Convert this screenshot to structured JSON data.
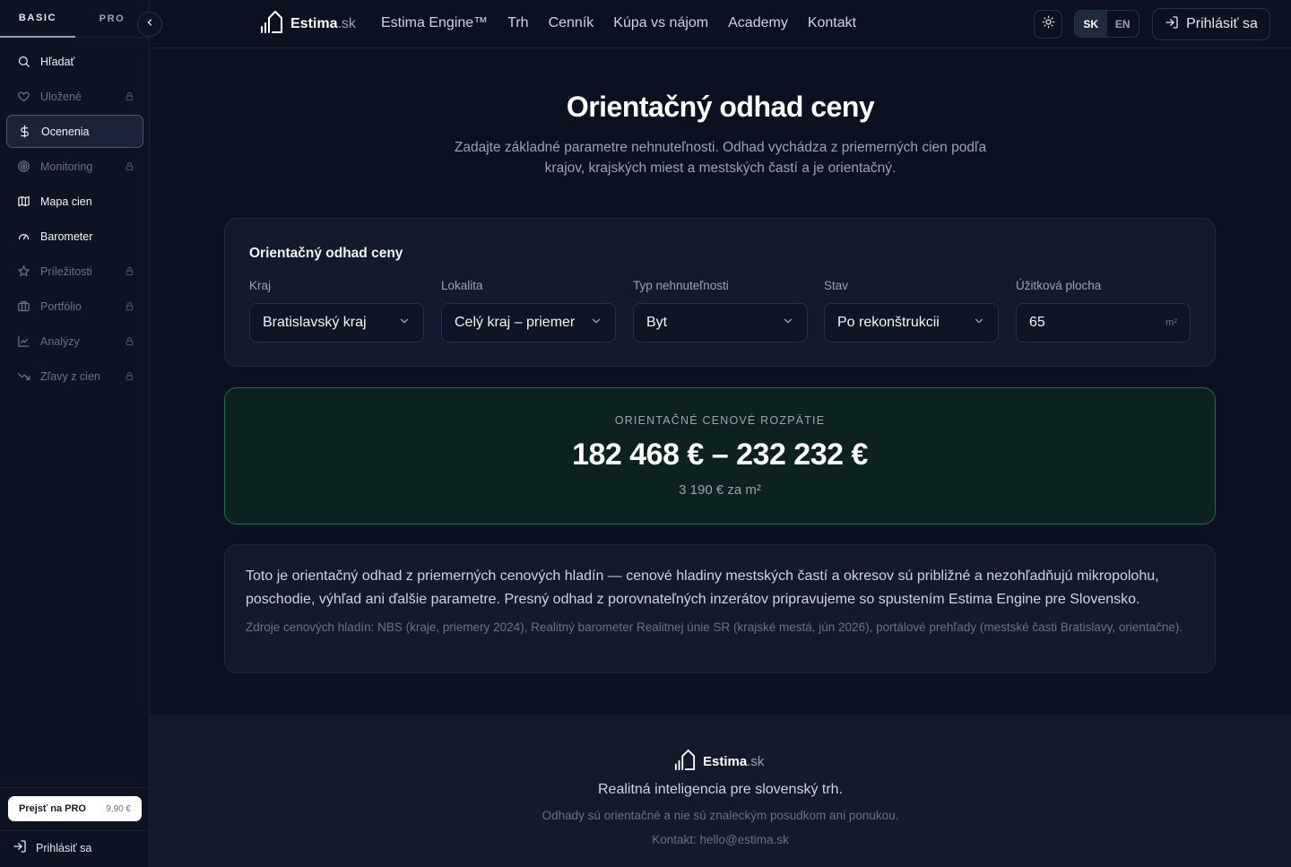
{
  "sidebar": {
    "tabs": {
      "basic": "BASIC",
      "pro": "PRO"
    },
    "items": [
      {
        "label": "Hľadať",
        "icon": "search-icon",
        "locked": false
      },
      {
        "label": "Uložené",
        "icon": "heart-icon",
        "locked": true
      },
      {
        "label": "Ocenenia",
        "icon": "dollar-icon",
        "locked": false,
        "active": true
      },
      {
        "label": "Monitoring",
        "icon": "radar-icon",
        "locked": true
      },
      {
        "label": "Mapa cien",
        "icon": "map-icon",
        "locked": false
      },
      {
        "label": "Barometer",
        "icon": "gauge-icon",
        "locked": false
      },
      {
        "label": "Príležitosti",
        "icon": "star-icon",
        "locked": true
      },
      {
        "label": "Portfólio",
        "icon": "building-icon",
        "locked": true
      },
      {
        "label": "Analýzy",
        "icon": "chart-line-icon",
        "locked": true
      },
      {
        "label": "Zľavy z cien",
        "icon": "trend-down-icon",
        "locked": true
      }
    ],
    "pro_cta": {
      "label": "Prejsť na PRO",
      "price": "9,90 €"
    },
    "login": "Prihlásiť sa"
  },
  "header": {
    "logo": {
      "name": "Estima",
      "tld": ".sk"
    },
    "nav": [
      "Estima Engine™",
      "Trh",
      "Cenník",
      "Kúpa vs nájom",
      "Academy",
      "Kontakt"
    ],
    "lang": {
      "sk": "SK",
      "en": "EN",
      "active": "SK"
    },
    "login": "Prihlásiť sa"
  },
  "main": {
    "title": "Orientačný odhad ceny",
    "subtitle": "Zadajte základné parametre nehnuteľnosti. Odhad vychádza z priemerných cien podľa krajov, krajských miest a mestských častí a je orientačný.",
    "form": {
      "title": "Orientačný odhad ceny",
      "fields": {
        "kraj": {
          "label": "Kraj",
          "value": "Bratislavský kraj"
        },
        "lokalita": {
          "label": "Lokalita",
          "value": "Celý kraj – priemer"
        },
        "typ": {
          "label": "Typ nehnuteľnosti",
          "value": "Byt"
        },
        "stav": {
          "label": "Stav",
          "value": "Po rekonštrukcii"
        },
        "plocha": {
          "label": "Úžitková plocha",
          "value": "65",
          "unit": "m²"
        }
      }
    },
    "result": {
      "caption": "ORIENTAČNÉ CENOVÉ ROZPÄTIE",
      "range": "182 468 € – 232 232 €",
      "per_m2": "3 190 € za m²"
    },
    "note": {
      "text": "Toto je orientačný odhad z priemerných cenových hladín — cenové hladiny mestských častí a okresov sú približné a nezohľadňujú mikropolohu, poschodie, výhľad ani ďalšie parametre. Presný odhad z porovnateľných inzerátov pripravujeme so spustením Estima Engine pre Slovensko.",
      "sources": "Zdroje cenových hladín: NBS (kraje, priemery 2024), Realitný barometer Realitnej únie SR (krajské mestá, jún 2026), portálové prehľady (mestské časti Bratislavy, orientačne)."
    }
  },
  "footer": {
    "logo": {
      "name": "Estima",
      "tld": ".sk"
    },
    "tagline": "Realitná inteligencia pre slovenský trh.",
    "disclaimer": "Odhady sú orientačné a nie sú znaleckým posudkom ani ponukou.",
    "contact": "Kontakt: hello@estima.sk"
  },
  "colors": {
    "background": "#0b1120",
    "panel": "#121a2b",
    "accent_green": "#1e6b4b"
  }
}
